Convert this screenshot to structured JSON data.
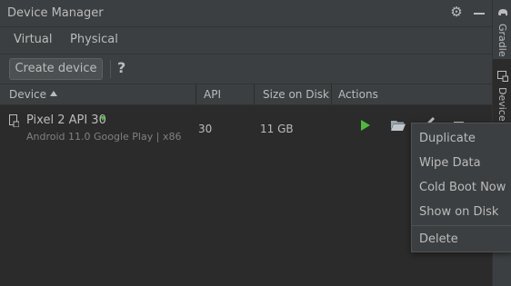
{
  "window": {
    "title": "Device Manager"
  },
  "tabs": [
    {
      "label": "Virtual",
      "selected": true
    },
    {
      "label": "Physical",
      "selected": false
    }
  ],
  "toolbar": {
    "create_label": "Create device",
    "help_label": "?"
  },
  "table": {
    "columns": [
      "Device",
      "API",
      "Size on Disk",
      "Actions"
    ],
    "sort": {
      "column": "Device",
      "direction": "ascending"
    },
    "rows": [
      {
        "name": "Pixel 2 API 30",
        "subtitle": "Android 11.0 Google Play | x86",
        "api": "30",
        "size": "11 GB",
        "online": true
      }
    ]
  },
  "context_menu": {
    "items": [
      "Duplicate",
      "Wipe Data",
      "Cold Boot Now",
      "Show on Disk",
      "Delete"
    ]
  },
  "side_strip": {
    "labels": [
      "Gradle",
      "Device Manager"
    ]
  },
  "colors": {
    "accent": "#4a88c7",
    "run_green": "#4fb83f",
    "panel_bg": "#2b2b2b",
    "chrome_bg": "#3c3f41"
  },
  "icons": [
    "gear-icon",
    "minimize-icon",
    "help-icon",
    "sort-ascending-icon",
    "device-phone-icon",
    "online-status-icon",
    "play-icon",
    "folder-icon",
    "edit-icon",
    "more-icon",
    "elephant-icon",
    "device-manager-icon"
  ]
}
